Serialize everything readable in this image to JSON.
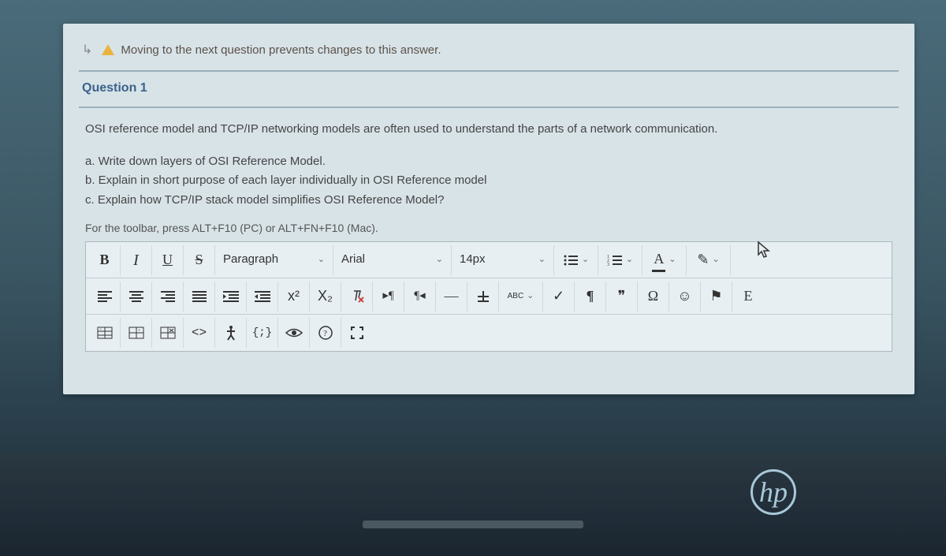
{
  "warning": {
    "text": "Moving to the next question prevents changes to this answer."
  },
  "question": {
    "header": "Question 1",
    "intro": "OSI reference model and TCP/IP networking models are often used to understand the parts of a network communication.",
    "parts": {
      "a": "a. Write down layers of OSI Reference Model.",
      "b": "b. Explain in short purpose of each layer individually in OSI Reference model",
      "c": "c. Explain how TCP/IP stack model simplifies OSI Reference Model?"
    },
    "toolbar_hint": "For the toolbar, press ALT+F10 (PC) or ALT+FN+F10 (Mac)."
  },
  "toolbar": {
    "bold": "B",
    "italic": "I",
    "underline": "U",
    "strike": "S",
    "format_select": "Paragraph",
    "font_select": "Arial",
    "size_select": "14px",
    "superscript": "x²",
    "subscript": "X₂",
    "ltr": "¶",
    "rtl": "¶",
    "abc": "ABC",
    "check": "✓",
    "pilcrow": "¶",
    "quote": "❞",
    "omega": "Ω",
    "smile": "☺",
    "flag": "⚑",
    "code": "<>",
    "anchor": "{;}",
    "font_color": "A",
    "highlight": "✎"
  },
  "logo": "hp"
}
